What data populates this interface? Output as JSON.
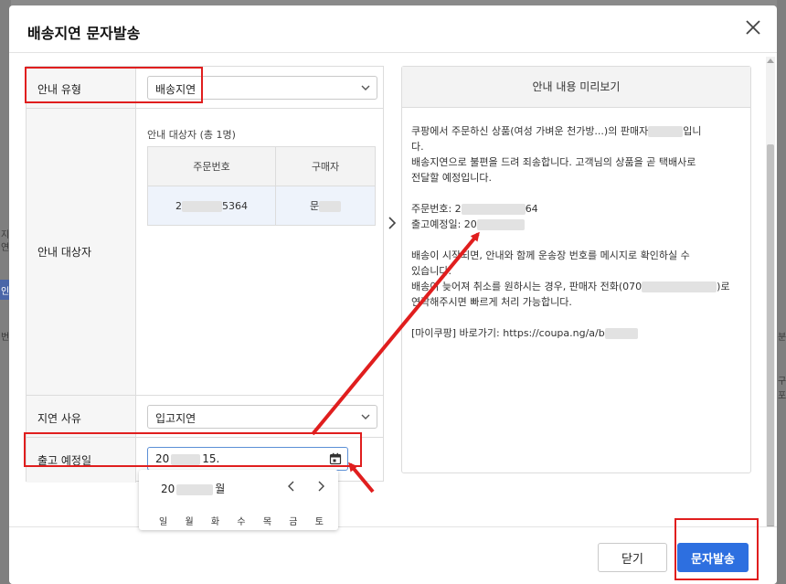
{
  "modal": {
    "title": "배송지연 문자발송"
  },
  "form": {
    "type_label": "안내 유형",
    "type_value": "배송지연",
    "target_label": "안내 대상자",
    "target_title": "안내 대상자 (총 1명)",
    "table_headers": [
      "주문번호",
      "구매자"
    ],
    "table_row": {
      "order_prefix": "2",
      "order_suffix": "5364",
      "buyer_prefix": "문"
    },
    "reason_label": "지연 사유",
    "reason_value": "입고지연",
    "date_label": "출고 예정일",
    "date_prefix": "20",
    "date_suffix": "15."
  },
  "calendar": {
    "month_prefix": "20",
    "month_suffix": "월",
    "weekdays": [
      "일",
      "월",
      "화",
      "수",
      "목",
      "금",
      "토"
    ]
  },
  "preview": {
    "title": "안내 내용 미리보기",
    "line1a": "쿠팡에서 주문하신 상품(여성 가벼운 천가방...)의 판매자",
    "line1b": "입니",
    "line2": "다.",
    "line3": "배송지연으로 불편을 드려 죄송합니다. 고객님의 상품을 곧 택배사로",
    "line4": "전달할 예정입니다.",
    "order_line_prefix": "주문번호: 2",
    "order_line_suffix": "64",
    "ship_line": "출고예정일: 20",
    "line7": "배송이 시작되면, 안내와 함께 운송장 번호를 메시지로 확인하실 수",
    "line8": "있습니다.",
    "line9a": "배송이 늦어져 취소를 원하시는 경우, 판매자 전화(070",
    "line9b": ")로",
    "line10": "연락해주시면 빠르게 처리 가능합니다.",
    "link_line": "[마이쿠팡] 바로가기: https://coupa.ng/a/b"
  },
  "footer": {
    "close_label": "닫기",
    "send_label": "문자발송"
  },
  "background": {
    "left_fragments": [
      "지",
      "연",
      "인",
      "번"
    ],
    "right_fragments": [
      "분",
      "구",
      "포"
    ]
  },
  "colors": {
    "accent": "#2d6fe0",
    "annotation": "#e01e1e"
  }
}
